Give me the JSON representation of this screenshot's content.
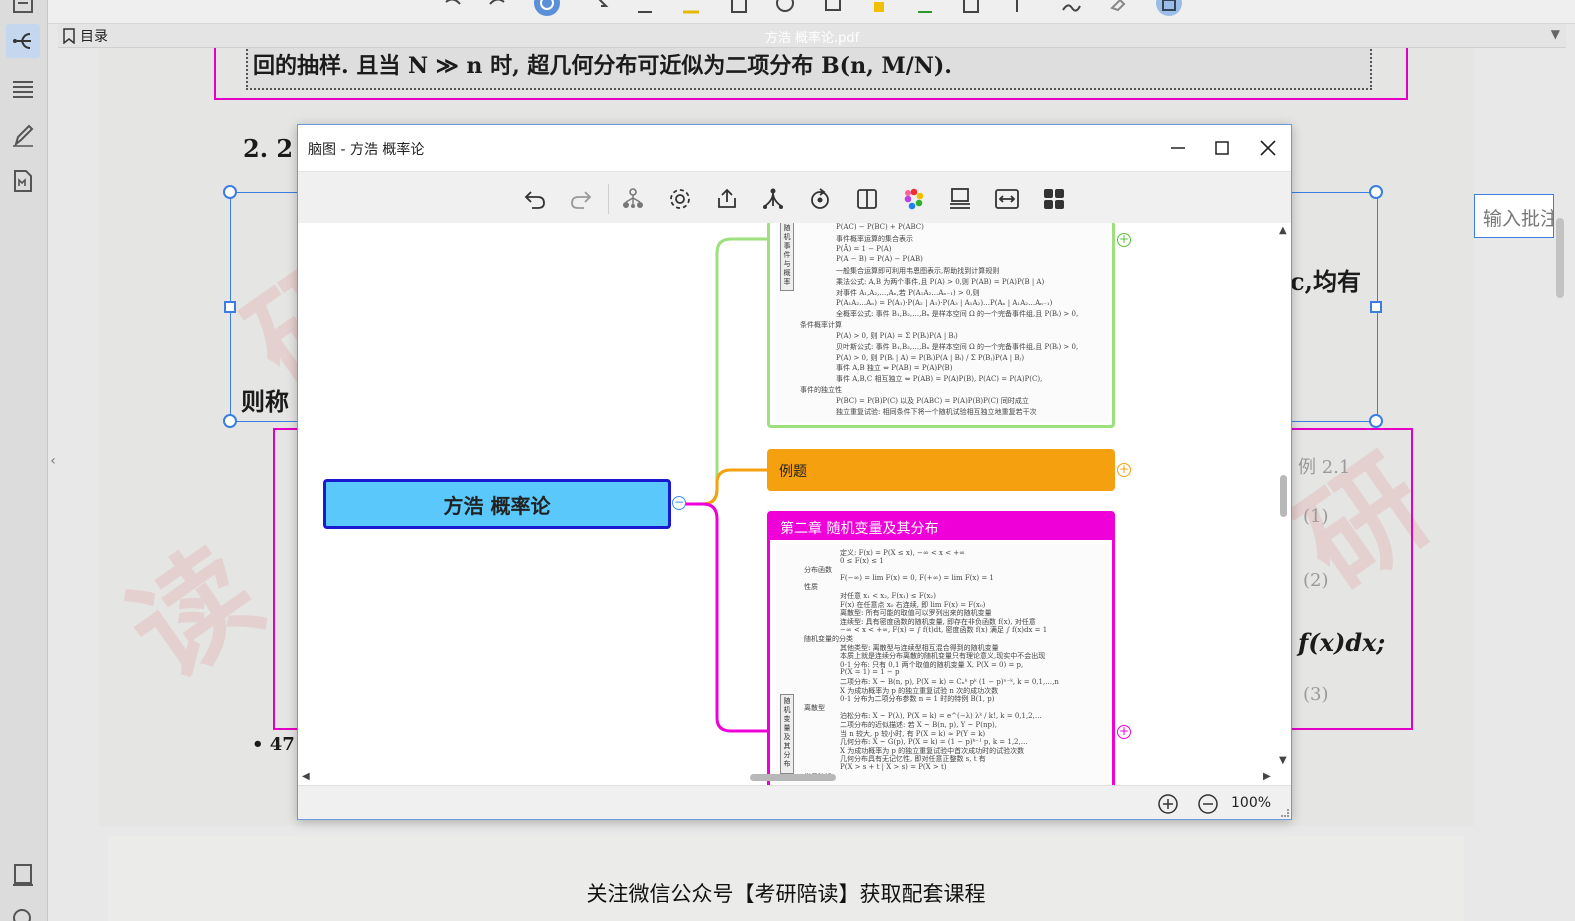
{
  "sidebar": {
    "items": [
      {
        "name": "thumbnails-icon"
      },
      {
        "name": "mindmap-icon"
      },
      {
        "name": "list-icon"
      },
      {
        "name": "pen-icon"
      },
      {
        "name": "markdown-file-icon"
      },
      {
        "name": "book-icon"
      },
      {
        "name": "search-icon"
      }
    ],
    "collapse_glyph": "‹"
  },
  "document_bar": {
    "toc_label": "目录",
    "file_title": "方浩 概率论.pdf"
  },
  "page": {
    "line1": "回的抽样. 且当 N ≫ n 时, 超几何分布可近似为二项分布 B(n, M/N).",
    "section": "2. 2",
    "right_text": "c,均有",
    "left_text": "则称",
    "formula": "f(x)dx;",
    "page_num": "• 47",
    "right_faint_1": "(1)",
    "right_faint_2": "(2)",
    "right_faint_3": "(3)",
    "right_faint_4": "例 2.1"
  },
  "annotation": {
    "placeholder": "输入批注"
  },
  "bottom_caption": "关注微信公众号【考研陪读】获取配套课程",
  "dialog": {
    "title": "脑图 - 方浩 概率论",
    "zoom": "100%",
    "toolbar": [
      {
        "name": "undo-icon"
      },
      {
        "name": "redo-icon"
      },
      {
        "name": "structure-icon"
      },
      {
        "name": "settings-icon"
      },
      {
        "name": "export-icon"
      },
      {
        "name": "branch-icon"
      },
      {
        "name": "refresh-icon"
      },
      {
        "name": "split-view-icon"
      },
      {
        "name": "color-palette-icon"
      },
      {
        "name": "layout-icon"
      },
      {
        "name": "fit-width-icon"
      },
      {
        "name": "grid-icon"
      }
    ]
  },
  "mindmap": {
    "root": "方浩 概率论",
    "nodes": [
      {
        "label": "",
        "color": "#9fe07e"
      },
      {
        "label": "例题",
        "color": "#f5a00f"
      },
      {
        "label": "第二章 随机变量及其分布",
        "color": "#f000d8"
      }
    ],
    "thumb1_lines": [
      "P(AC) − P(BC) + P(ABC)",
      "事件概率运算的集合表示",
      "P(Ā) = 1 − P(A)",
      "P(A − B) = P(A) − P(AB)",
      "一般集合运算即可利用韦恩图表示,帮助找到计算规则",
      "乘法公式: A,B 为两个事件,且 P(A) > 0,则 P(AB) = P(A)P(B | A)",
      "对事件 A₁,A₂,…,Aₙ,若 P(A₁A₂…Aₙ₋₁) > 0,则",
      "P(A₁A₂…Aₙ) = P(A₁)·P(A₂ | A₁)·P(A₃ | A₁A₂)…P(Aₙ | A₁A₂…Aₙ₋₁)",
      "全概率公式: 事件 B₁,B₂,…,Bₙ 是样本空间 Ω 的一个完备事件组,且 P(Bᵢ) > 0,",
      "条件概率计算",
      "P(A) > 0, 则 P(A) = Σ P(Bᵢ)P(A | Bᵢ)",
      "贝叶斯公式: 事件 B₁,B₂,…,Bₙ 是样本空间 Ω 的一个完备事件组,且 P(Bᵢ) > 0,",
      "P(A) > 0, 则 P(Bᵢ | A) = P(Bᵢ)P(A | Bᵢ) / Σ P(Bⱼ)P(A | Bⱼ)",
      "事件 A,B 独立 ⇔ P(AB) = P(A)P(B)",
      "事件 A,B,C 相互独立 ⇔ P(AB) = P(A)P(B), P(AC) = P(A)P(C),",
      "事件的独立性",
      "P(BC) = P(B)P(C) 以及 P(ABC) = P(A)P(B)P(C) 同时成立",
      "独立重复试验: 相同条件下将一个随机试验相互独立地重复若干次"
    ],
    "thumb2_lines": [
      "定义: F(x) = P(X ≤ x), −∞ < x < +∞",
      "0 ≤ F(x) ≤ 1",
      "分布函数",
      "F(−∞) = lim F(x) = 0, F(+∞) = lim F(x) = 1",
      "性质",
      "对任意 x₁ < x₂, F(x₁) ≤ F(x₂)",
      "F(x) 在任意点 x₀ 右连续, 即 lim F(x) = F(x₀)",
      "离散型: 所有可能的取值可以罗列出来的随机变量",
      "连续型: 具有密度函数的随机变量, 即存在非负函数 f(x), 对任意",
      "−∞ < x < +∞, F(x) = ∫ f(t)dt, 密度函数 f(x) 满足 ∫ f(x)dx = 1",
      "随机变量的分类",
      "其他类型: 离散型与连续型相互混合得到的随机变量",
      "本质上就是连续分布离散的随机变量只有理论意义,现实中不会出现",
      "0-1 分布: 只有 0,1 两个取值的随机变量 X, P(X = 0) = p,",
      "P(X = 1) = 1 − p",
      "二项分布: X ~ B(n, p), P(X = k) = Cₙᵏ pᵏ (1 − p)ⁿ⁻ᵏ, k = 0,1,…,n",
      "X 为成功概率为 p 的独立重复试验 n 次的成功次数",
      "0-1 分布为二项分布参数 n = 1 时的特例 B(1, p)",
      "离散型",
      "泊松分布: X ~ P(λ), P(X = k) = e^(−λ) λᵏ / k!, k = 0,1,2,…",
      "二项分布的近似描述: 若 X ~ B(n, p), Y ~ P(np),",
      "当 n 较大, p 较小时, 有 P(X = k) ≈ P(Y = k)",
      "几何分布: X ~ G(p), P(X = k) = (1 − p)ᵏ⁻¹ p, k = 1,2,…",
      "X 为成功概率为 p 的独立重复试验中首次成功时的试验次数",
      "几何分布具有无记忆性, 即对任意正整数 s, t 有",
      "P(X > s + t | X > s) = P(X > t)",
      "常见随机"
    ],
    "thumb1_vlabel": "随机事件与概率",
    "thumb2_vlabel": "随机变量及其分布"
  }
}
